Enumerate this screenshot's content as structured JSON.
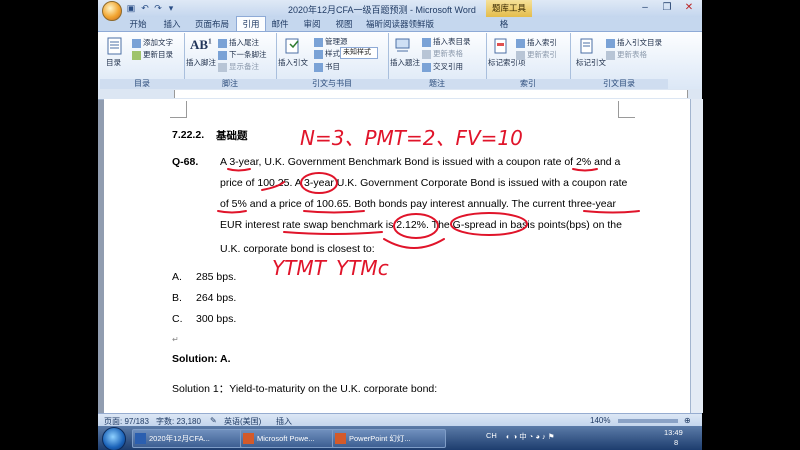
{
  "window": {
    "title": "2020年12月CFA一级百题预测 - Microsoft Word",
    "context_tab": "题库工具"
  },
  "tabs": [
    "开始",
    "插入",
    "页面布局",
    "引用",
    "邮件",
    "审阅",
    "视图",
    "福昕阅读器领鲜版",
    "格"
  ],
  "active_tab": "引用",
  "ribbon": {
    "groups": [
      {
        "label": "目录",
        "items": [
          "目录",
          "添加文字",
          "更新目录"
        ]
      },
      {
        "label": "脚注",
        "items": [
          "插入脚注",
          "插入尾注",
          "下一条脚注",
          "显示备注"
        ]
      },
      {
        "label": "引文与书目",
        "items": [
          "插入引文",
          "管理源",
          "样式:",
          "未知样式",
          "书目"
        ]
      },
      {
        "label": "题注",
        "items": [
          "插入题注",
          "插入表目录",
          "更新表格",
          "交叉引用"
        ]
      },
      {
        "label": "索引",
        "items": [
          "标记索引项",
          "插入索引",
          "更新索引"
        ]
      },
      {
        "label": "引文目录",
        "items": [
          "标记引文",
          "插入引文目录",
          "更新表格"
        ]
      }
    ]
  },
  "document": {
    "section": "7.22.2.",
    "section_title": "基础题",
    "question_label": "Q-68.",
    "question_lines": [
      "A 3-year, U.K. Government Benchmark Bond is issued with a coupon rate of 2% and a",
      "price of 100.25. A 3-year U.K. Government Corporate Bond is issued with a coupon rate",
      "of 5% and a price of 100.65. Both bonds pay interest annually. The current three-year",
      "EUR interest rate swap benchmark is 2.12%. The G-spread in basis points(bps) on the",
      "U.K. corporate bond is closest to:"
    ],
    "options": [
      {
        "letter": "A.",
        "text": "285 bps."
      },
      {
        "letter": "B.",
        "text": "264 bps."
      },
      {
        "letter": "C.",
        "text": "300 bps."
      }
    ],
    "solution": "Solution: A.",
    "solution_1": "Solution 1：Yield-to-maturity on the U.K. corporate bond:",
    "handwriting": {
      "top": "N=3、PMT=2、FV=10",
      "bottom_left": "YTMT",
      "bottom_right": "YTMc"
    }
  },
  "status_bar": {
    "page": "页面: 97/183",
    "words": "字数: 23,180",
    "language": "英语(美国)",
    "insert": "插入",
    "zoom": "140%"
  },
  "taskbar": {
    "tasks": [
      "2020年12月CFA...",
      "Microsoft Powe...",
      "PowerPoint 幻灯..."
    ],
    "ime": "CH",
    "time": "13:49",
    "date": "8"
  }
}
